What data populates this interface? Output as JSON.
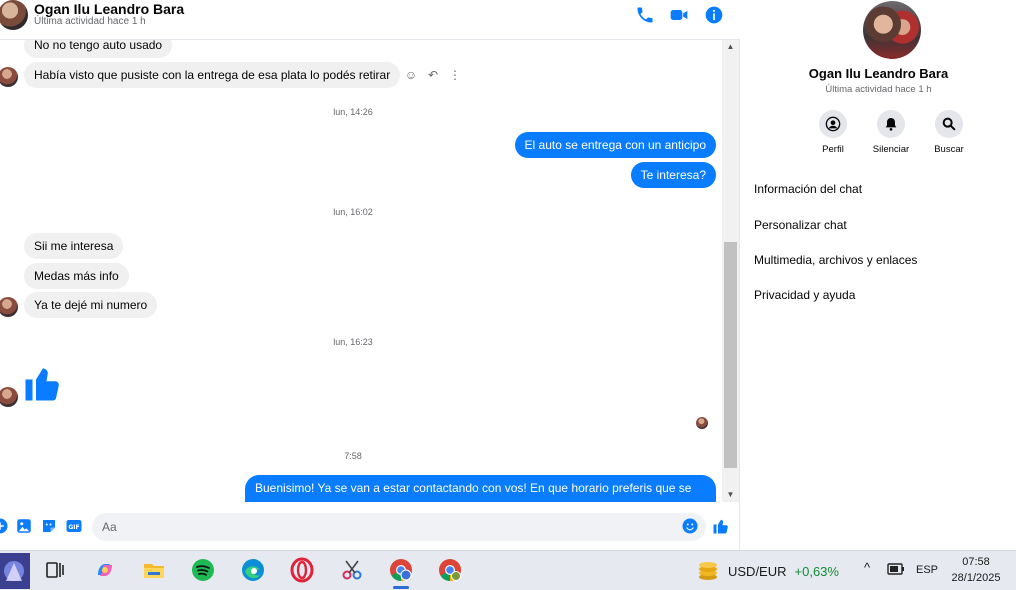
{
  "header": {
    "contact_name": "Ogan Ilu Leandro Bara",
    "status": "Última actividad hace 1 h",
    "icons": [
      "phone-icon",
      "video-camera-icon",
      "info-icon"
    ]
  },
  "messages": {
    "m1": "No no tengo auto usado",
    "m2": "Había visto que pusiste con la entrega de esa plata lo podés retirar",
    "ts1": "lun, 14:26",
    "m3": "El auto se entrega con un anticipo",
    "m4": "Te interesa?",
    "ts2": "lun, 16:02",
    "m5": "Sii me interesa",
    "m6": "Medas más info",
    "m7": "Ya te dejé mi numero",
    "ts3": "lun, 16:23",
    "like": "thumbs-up-icon",
    "ts4": "7:58",
    "m8": "Buenisimo! Ya se van a estar contactando con vos! En que horario preferis que se"
  },
  "composer": {
    "placeholder": "Aa",
    "icons": [
      "plus-circle-icon",
      "image-icon",
      "sticker-icon",
      "gif-icon",
      "emoji-icon",
      "like-icon"
    ]
  },
  "panel": {
    "name": "Ogan Ilu Leandro Bara",
    "status": "Última actividad hace 1 h",
    "actions": [
      {
        "label": "Perfil",
        "icon": "profile-icon"
      },
      {
        "label": "Silenciar",
        "icon": "bell-icon"
      },
      {
        "label": "Buscar",
        "icon": "search-icon"
      }
    ],
    "menu": [
      "Información del chat",
      "Personalizar chat",
      "Multimedia, archivos y enlaces",
      "Privacidad y ayuda"
    ]
  },
  "taskbar": {
    "apps": [
      "start-icon",
      "task-view-icon",
      "copilot-icon",
      "file-explorer-icon",
      "spotify-icon",
      "edge-icon",
      "opera-icon",
      "snipping-tool-icon",
      "chrome-icon",
      "chrome-profile-icon"
    ],
    "widget_pair": "USD/EUR",
    "widget_change": "+0,63%",
    "language": "ESP",
    "time": "07:58",
    "date": "28/1/2025"
  },
  "colors": {
    "accent": "#0a7cff",
    "incoming_bubble": "#f0f0f0",
    "positive": "#138a36"
  }
}
